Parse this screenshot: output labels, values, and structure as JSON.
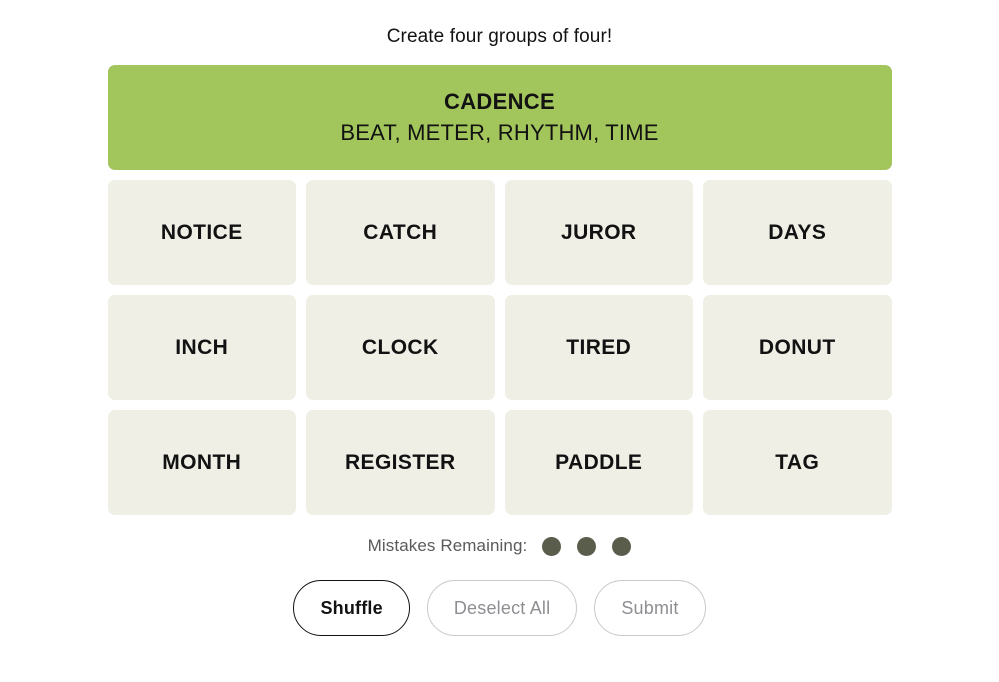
{
  "headline": "Create four groups of four!",
  "solved": [
    {
      "title": "CADENCE",
      "words": "BEAT, METER, RHYTHM, TIME",
      "color": "#a2c55c"
    }
  ],
  "grid": {
    "rows": [
      [
        "NOTICE",
        "CATCH",
        "JUROR",
        "DAYS"
      ],
      [
        "INCH",
        "CLOCK",
        "TIRED",
        "DONUT"
      ],
      [
        "MONTH",
        "REGISTER",
        "PADDLE",
        "TAG"
      ]
    ],
    "tile_color": "#efefe6",
    "text_color": "#121212"
  },
  "mistakes": {
    "label": "Mistakes Remaining:",
    "remaining": 3,
    "dot_color": "#5a5c4c"
  },
  "controls": [
    {
      "label": "Shuffle",
      "state": "enabled"
    },
    {
      "label": "Deselect All",
      "state": "disabled"
    },
    {
      "label": "Submit",
      "state": "disabled"
    }
  ]
}
